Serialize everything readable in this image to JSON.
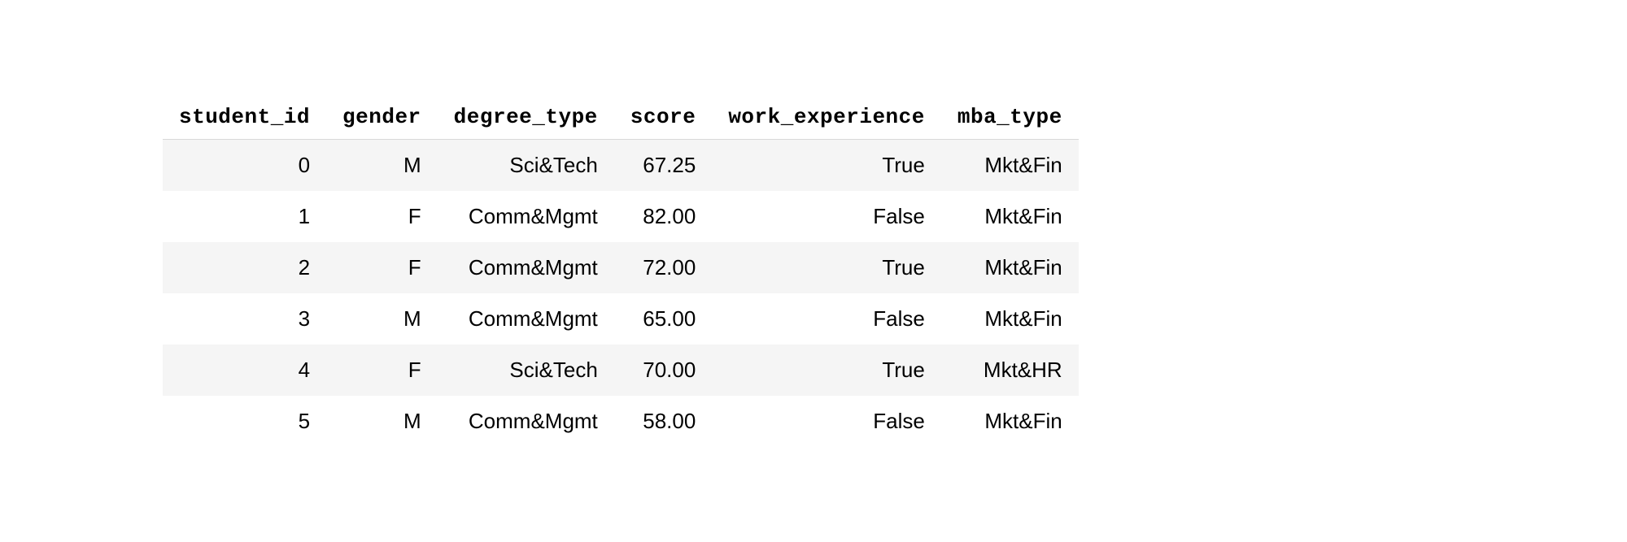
{
  "chart_data": {
    "type": "table",
    "columns": [
      "student_id",
      "gender",
      "degree_type",
      "score",
      "work_experience",
      "mba_type"
    ],
    "rows": [
      {
        "student_id": "0",
        "gender": "M",
        "degree_type": "Sci&Tech",
        "score": "67.25",
        "work_experience": "True",
        "mba_type": "Mkt&Fin"
      },
      {
        "student_id": "1",
        "gender": "F",
        "degree_type": "Comm&Mgmt",
        "score": "82.00",
        "work_experience": "False",
        "mba_type": "Mkt&Fin"
      },
      {
        "student_id": "2",
        "gender": "F",
        "degree_type": "Comm&Mgmt",
        "score": "72.00",
        "work_experience": "True",
        "mba_type": "Mkt&Fin"
      },
      {
        "student_id": "3",
        "gender": "M",
        "degree_type": "Comm&Mgmt",
        "score": "65.00",
        "work_experience": "False",
        "mba_type": "Mkt&Fin"
      },
      {
        "student_id": "4",
        "gender": "F",
        "degree_type": "Sci&Tech",
        "score": "70.00",
        "work_experience": "True",
        "mba_type": "Mkt&HR"
      },
      {
        "student_id": "5",
        "gender": "M",
        "degree_type": "Comm&Mgmt",
        "score": "58.00",
        "work_experience": "False",
        "mba_type": "Mkt&Fin"
      }
    ]
  }
}
